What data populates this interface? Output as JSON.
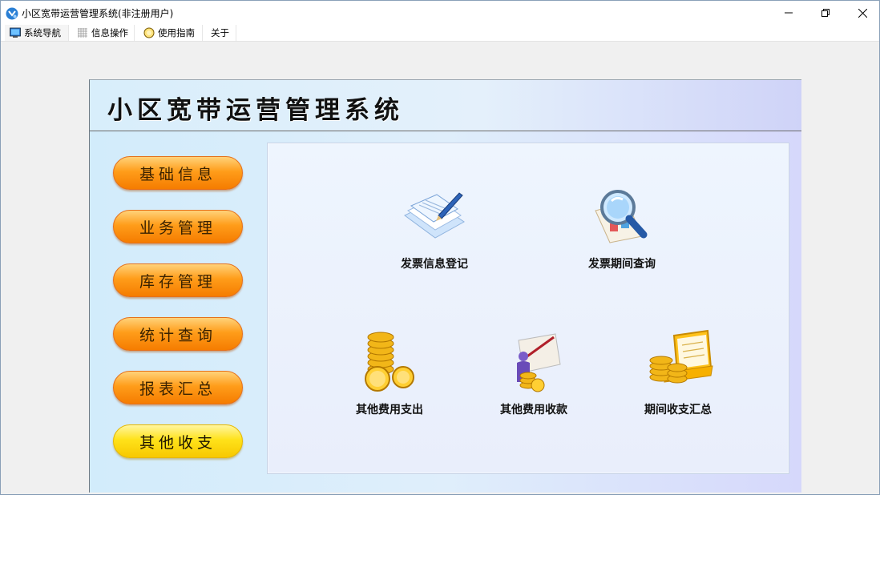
{
  "window": {
    "title": "小区宽带运营管理系统(非注册用户)",
    "controls": [
      "minimize",
      "restore",
      "close"
    ]
  },
  "menu": [
    {
      "label": "系统导航",
      "icon": "monitor-icon"
    },
    {
      "label": "信息操作",
      "icon": "grid-icon"
    },
    {
      "label": "使用指南",
      "icon": "guide-icon"
    },
    {
      "label": "关于",
      "icon": ""
    }
  ],
  "header": {
    "title": "小区宽带运营管理系统"
  },
  "nav": [
    {
      "label": "基础信息",
      "style": "orange"
    },
    {
      "label": "业务管理",
      "style": "orange"
    },
    {
      "label": "库存管理",
      "style": "orange"
    },
    {
      "label": "统计查询",
      "style": "orange"
    },
    {
      "label": "报表汇总",
      "style": "orange"
    },
    {
      "label": "其他收支",
      "style": "yellow"
    }
  ],
  "tiles": [
    {
      "label": "发票信息登记",
      "icon": "document-pen-icon"
    },
    {
      "label": "发票期间查询",
      "icon": "magnifier-icon"
    },
    {
      "label": "其他费用支出",
      "icon": "coins-icon"
    },
    {
      "label": "其他费用收款",
      "icon": "person-coin-icon"
    },
    {
      "label": "期间收支汇总",
      "icon": "laptop-coins-icon"
    }
  ],
  "colors": {
    "nav_orange": "#ff9d1a",
    "nav_yellow": "#ffe21a",
    "panel_bg": "#dfeefb"
  }
}
